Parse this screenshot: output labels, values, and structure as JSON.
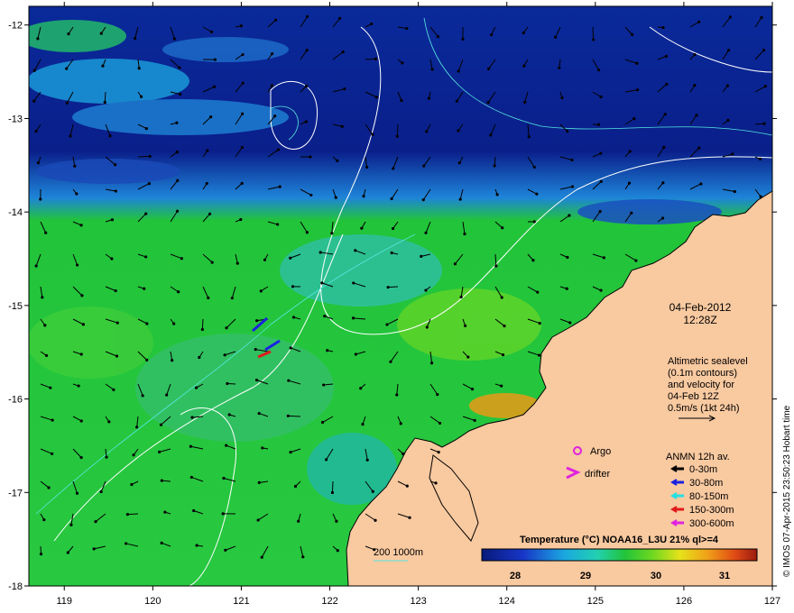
{
  "map": {
    "lon_ticks": [
      "119",
      "120",
      "121",
      "122",
      "123",
      "124",
      "125",
      "126",
      "127"
    ],
    "lat_ticks": [
      "-12",
      "-13",
      "-14",
      "-15",
      "-16",
      "-17",
      "-18"
    ],
    "lon_range": [
      118.6,
      127
    ],
    "lat_range": [
      -18,
      -11.8
    ]
  },
  "info": {
    "date": "04-Feb-2012",
    "time": "12:28Z",
    "altimetry_lines": [
      "Altimetric sealevel",
      "(0.1m contours)",
      "and velocity for",
      "04-Feb 12Z",
      "0.5m/s (1kt 24h)"
    ]
  },
  "legend": {
    "argo_label": "Argo",
    "drifter_label": "drifter",
    "anmn_title": "ANMN 12h av.",
    "depth_items": [
      {
        "label": "0-30m",
        "color": "#000000"
      },
      {
        "label": "30-80m",
        "color": "#1a22e0"
      },
      {
        "label": "80-150m",
        "color": "#22e0e0"
      },
      {
        "label": "150-300m",
        "color": "#e01a1a"
      },
      {
        "label": "300-600m",
        "color": "#e022e0"
      }
    ]
  },
  "colorbar": {
    "title": "Temperature (°C) NOAA16_L3U 21% ql>=4",
    "ticks": [
      "28",
      "29",
      "30",
      "31"
    ]
  },
  "isobath_label": "200  1000m",
  "credit": "© IMOS 07-Apr-2015 23:50:23 Hobart time",
  "colors": {
    "land": "#f9c9a0",
    "sst_cold": "#0a1f8a",
    "sst_mid": "#22c43a",
    "sst_warm": "#e8561a"
  }
}
